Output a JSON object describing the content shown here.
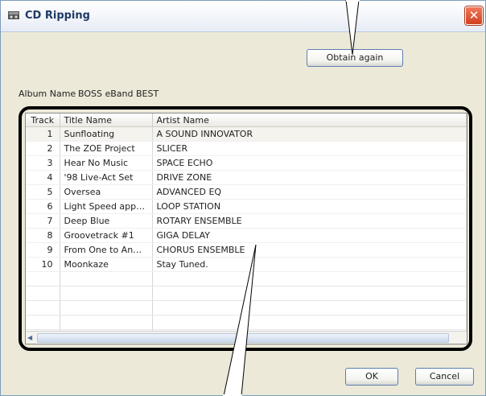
{
  "window": {
    "title": "CD Ripping",
    "close_label": "✕"
  },
  "buttons": {
    "obtain_again": "Obtain again",
    "ok": "OK",
    "cancel": "Cancel"
  },
  "album": {
    "label": "Album Name",
    "value": "BOSS eBand BEST"
  },
  "table": {
    "headers": {
      "track": "Track",
      "title": "Title Name",
      "artist": "Artist Name"
    },
    "rows": [
      {
        "track": "1",
        "title": "Sunfloating",
        "artist": "A SOUND INNOVATOR"
      },
      {
        "track": "2",
        "title": "The ZOE Project",
        "artist": "SLICER"
      },
      {
        "track": "3",
        "title": "Hear No Music",
        "artist": "SPACE ECHO"
      },
      {
        "track": "4",
        "title": "'98 Live-Act Set",
        "artist": "DRIVE ZONE"
      },
      {
        "track": "5",
        "title": "Oversea",
        "artist": "ADVANCED EQ"
      },
      {
        "track": "6",
        "title": "Light Speed app…",
        "artist": "LOOP STATION"
      },
      {
        "track": "7",
        "title": "Deep Blue",
        "artist": "ROTARY ENSEMBLE"
      },
      {
        "track": "8",
        "title": "Groovetrack #1",
        "artist": "GIGA DELAY"
      },
      {
        "track": "9",
        "title": "From One to An…",
        "artist": "CHORUS ENSEMBLE"
      },
      {
        "track": "10",
        "title": "Moonkaze",
        "artist": "Stay Tuned."
      }
    ]
  },
  "icons": {
    "title_icon": "cd-drive-icon",
    "close": "close-icon",
    "scroll_left": "scroll-left-arrow-icon"
  }
}
